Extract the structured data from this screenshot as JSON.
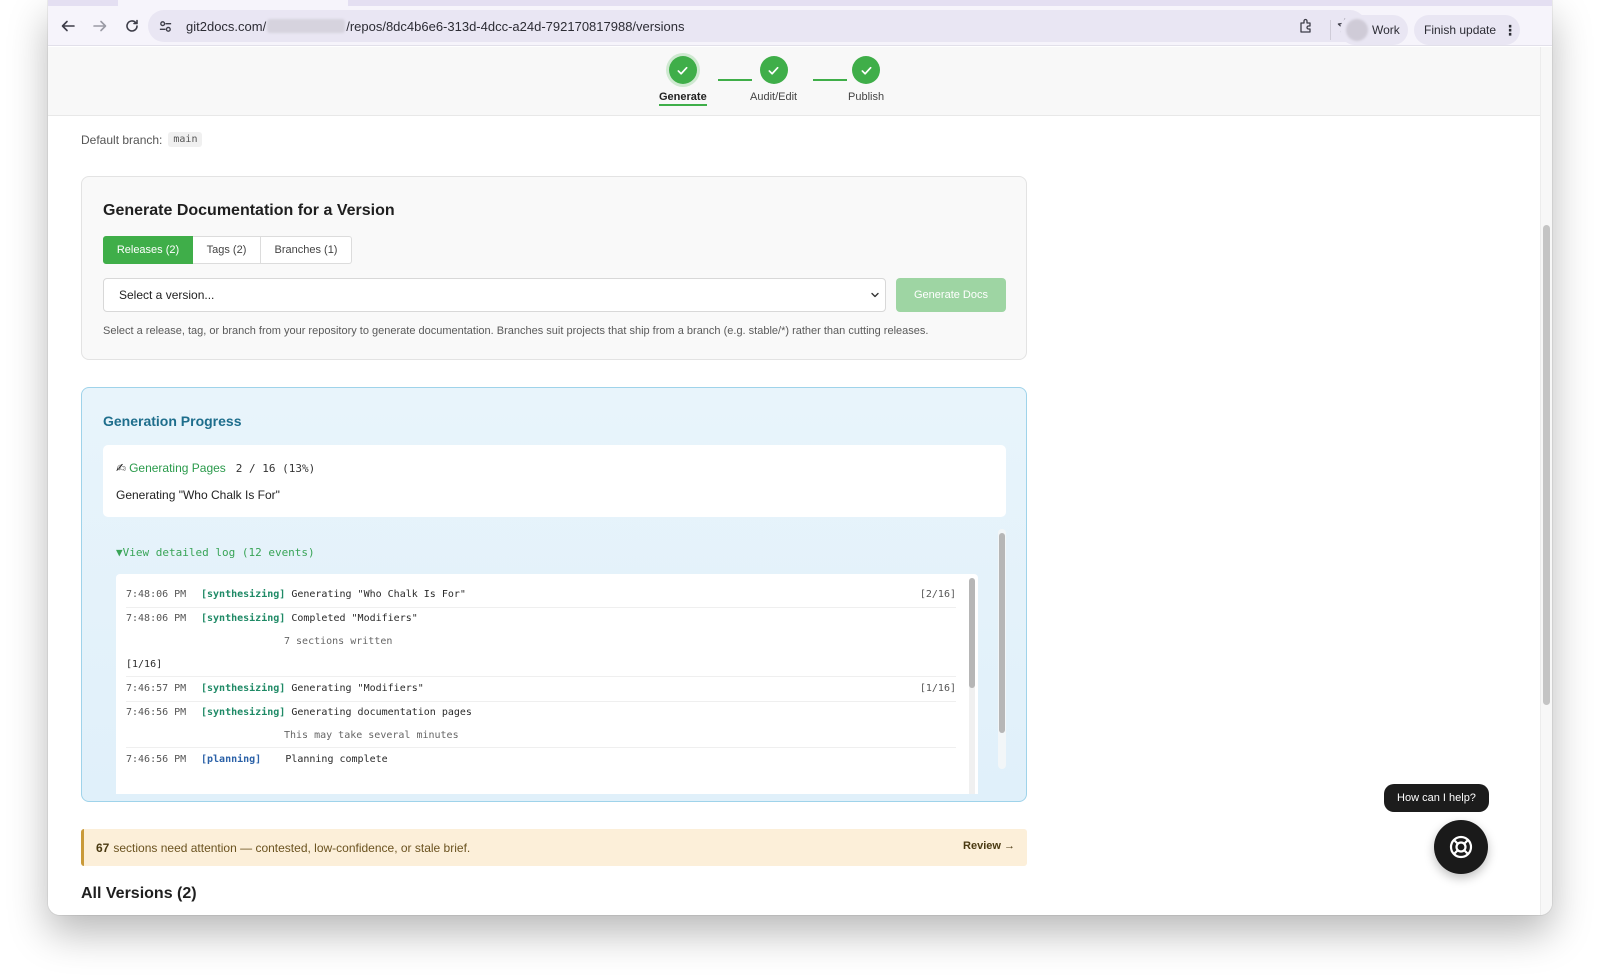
{
  "browser": {
    "url_prefix": "git2docs.com/",
    "url_suffix": "/repos/8dc4b6e6-313d-4dcc-a24d-792170817988/versions",
    "profile_label": "Work",
    "finish_update_label": "Finish update"
  },
  "stepper": {
    "steps": [
      {
        "label": "Generate"
      },
      {
        "label": "Audit/Edit"
      },
      {
        "label": "Publish"
      }
    ]
  },
  "repo": {
    "default_branch_label": "Default branch:",
    "default_branch": "main"
  },
  "generate": {
    "title": "Generate Documentation for a Version",
    "tabs": [
      {
        "label": "Releases (2)"
      },
      {
        "label": "Tags (2)"
      },
      {
        "label": "Branches (1)"
      }
    ],
    "select_placeholder": "Select a version...",
    "button_label": "Generate Docs",
    "help_text": "Select a release, tag, or branch from your repository to generate documentation. Branches suit projects that ship from a branch (e.g. stable/*) rather than cutting releases."
  },
  "progress": {
    "title": "Generation Progress",
    "phase_icon": "✍",
    "phase": "Generating Pages",
    "count": "2 / 16 (13%)",
    "current": "Generating \"Who Chalk Is For\"",
    "log_toggle": "▼View detailed log (12 events)",
    "log": [
      {
        "time": "7:48:06 PM",
        "tag": "[synthesizing]",
        "message": "Generating \"Who Chalk Is For\"",
        "step": "[2/16]"
      },
      {
        "time": "7:48:06 PM",
        "tag": "[synthesizing]",
        "message": "Completed \"Modifiers\"",
        "note": "7 sections written",
        "step_line": "[1/16]"
      },
      {
        "time": "7:46:57 PM",
        "tag": "[synthesizing]",
        "message": "Generating \"Modifiers\"",
        "step": "[1/16]"
      },
      {
        "time": "7:46:56 PM",
        "tag": "[synthesizing]",
        "message": "Generating documentation pages",
        "note": "This may take several minutes"
      },
      {
        "time": "7:46:56 PM",
        "tag": "[planning]",
        "message": "Planning complete"
      }
    ]
  },
  "attention": {
    "count": "67",
    "text": "sections need attention — contested, low-confidence, or stale brief.",
    "review_label": "Review →"
  },
  "all_versions": {
    "title": "All Versions (2)"
  },
  "help": {
    "bubble_text": "How can I help?"
  }
}
